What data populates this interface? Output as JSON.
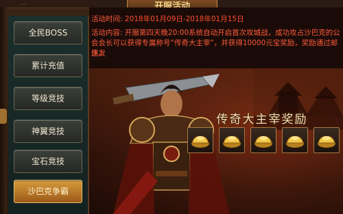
{
  "window": {
    "title": "开服活动",
    "top_strip_text": "…"
  },
  "sidebar": {
    "items": [
      {
        "label": "全民BOSS",
        "active": false
      },
      {
        "label": "累计充值",
        "active": false
      },
      {
        "label": "等级竞技",
        "active": false
      },
      {
        "label": "神翼竞技",
        "active": false
      },
      {
        "label": "宝石竞技",
        "active": false
      },
      {
        "label": "沙巴克争霸",
        "active": true
      }
    ]
  },
  "activity": {
    "time_label": "活动时间:",
    "time_range": "2018年01月09日-2018年01月15日",
    "content_label": "活动内容:",
    "content_line1": "开服第四天晚20:00系统自动开启首次攻城战，成功攻占沙巴克的公",
    "content_line2": "会会长可以获得专属称号“传奇大主宰”，并获得10000元宝奖励，奖励通过邮件发",
    "content_line3": "送。"
  },
  "reward": {
    "title": "传奇大主宰奖励",
    "slots": [
      {
        "icon": "gold-ingot-icon"
      },
      {
        "icon": "gold-ingot-icon"
      },
      {
        "icon": "gold-ingot-icon"
      },
      {
        "icon": "gold-ingot-icon"
      },
      {
        "icon": "gold-ingot-icon"
      }
    ]
  },
  "colors": {
    "accent_red": "#ff5a3a",
    "gold": "#f0c46a",
    "sidebar_bg": "#1b2f2c"
  }
}
